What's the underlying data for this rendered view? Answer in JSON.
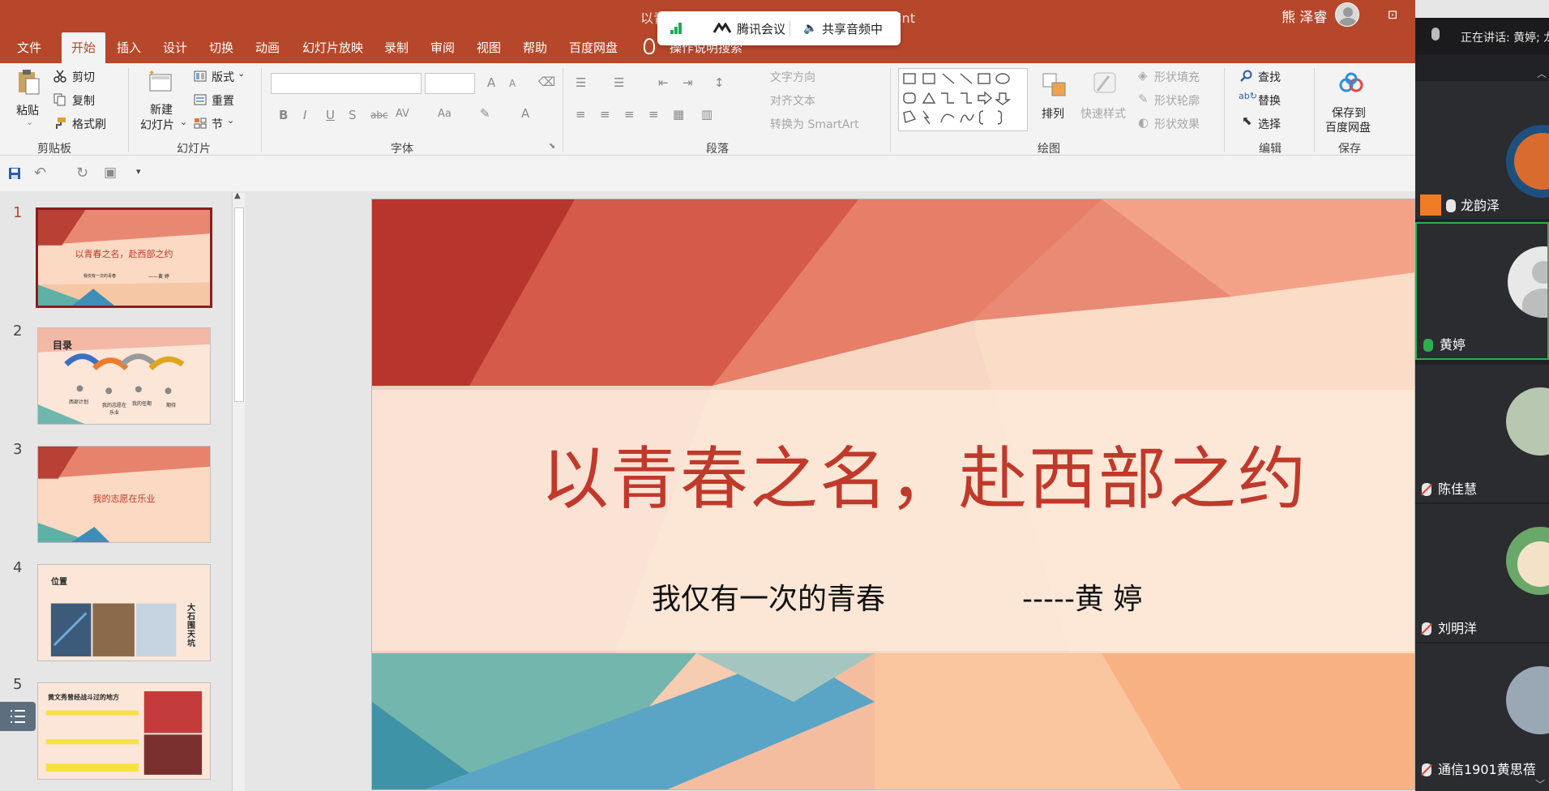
{
  "window": {
    "title": "以青春之名，赴西部之约（黄婷）- PowerPoint",
    "user_name": "熊 泽睿",
    "controls": {
      "ribbon_toggle": "⊡",
      "minimize": "—",
      "restore": "❐",
      "close": "✕"
    }
  },
  "menu": {
    "tabs": [
      "文件",
      "开始",
      "插入",
      "设计",
      "切换",
      "动画",
      "幻灯片放映",
      "录制",
      "审阅",
      "视图",
      "帮助",
      "百度网盘"
    ],
    "active_tab": "开始",
    "tell_me": "操作说明搜索"
  },
  "meeting_float": {
    "app_name": "腾讯会议",
    "audio_status": "共享音频中",
    "signal_color": "#1aad5a"
  },
  "ribbon": {
    "clipboard": {
      "paste": "粘贴",
      "cut": "剪切",
      "copy": "复制",
      "format_painter": "格式刷",
      "label": "剪贴板"
    },
    "slides": {
      "new_slide_line1": "新建",
      "new_slide_line2": "幻灯片",
      "layout": "版式",
      "reset": "重置",
      "section": "节",
      "label": "幻灯片"
    },
    "font": {
      "label": "字体",
      "bold": "B",
      "italic": "I",
      "underline": "U",
      "shadow": "S",
      "strike": "abc",
      "spacing": "AV",
      "case": "Aa",
      "grow": "A",
      "shrink": "A",
      "color": "A"
    },
    "paragraph": {
      "label": "段落",
      "text_direction": "文字方向",
      "align_text": "对齐文本",
      "smartart": "转换为 SmartArt"
    },
    "drawing": {
      "label": "绘图",
      "arrange": "排列",
      "quick_styles": "快速样式",
      "shape_fill": "形状填充",
      "shape_outline": "形状轮廓",
      "shape_effects": "形状效果"
    },
    "editing": {
      "label": "编辑",
      "find": "查找",
      "replace": "替换",
      "select": "选择"
    },
    "save": {
      "label": "保存",
      "save_to_1": "保存到",
      "save_to_2": "百度网盘"
    }
  },
  "thumbnails": [
    {
      "num": "1",
      "title": "以青春之名，赴西部之约",
      "sub": "我仅有一次的青春",
      "author": "——黄 婷",
      "active": true
    },
    {
      "num": "2",
      "title": "目录",
      "items": [
        "西部计划",
        "我的志愿在乐业",
        "我的任期",
        "期待"
      ]
    },
    {
      "num": "3",
      "title": "我的志愿在乐业"
    },
    {
      "num": "4",
      "title": "位置",
      "side": "大石围天坑"
    },
    {
      "num": "5",
      "title": "黄文秀曾经战斗过的地方"
    }
  ],
  "slide": {
    "title": "以青春之名，赴西部之约",
    "subtitle": "我仅有一次的青春",
    "author": "-----黄 婷",
    "title_color": "#c0392b"
  },
  "participants_panel": {
    "speaking_label": "正在讲话: 黄婷; 龙",
    "participants": [
      {
        "name": "龙韵泽",
        "mic": "on",
        "host": true
      },
      {
        "name": "黄婷",
        "mic": "active",
        "speaking": true
      },
      {
        "name": "陈佳慧",
        "mic": "off"
      },
      {
        "name": "刘明洋",
        "mic": "off"
      },
      {
        "name": "通信1901黄思蓓",
        "mic": "off"
      }
    ]
  }
}
